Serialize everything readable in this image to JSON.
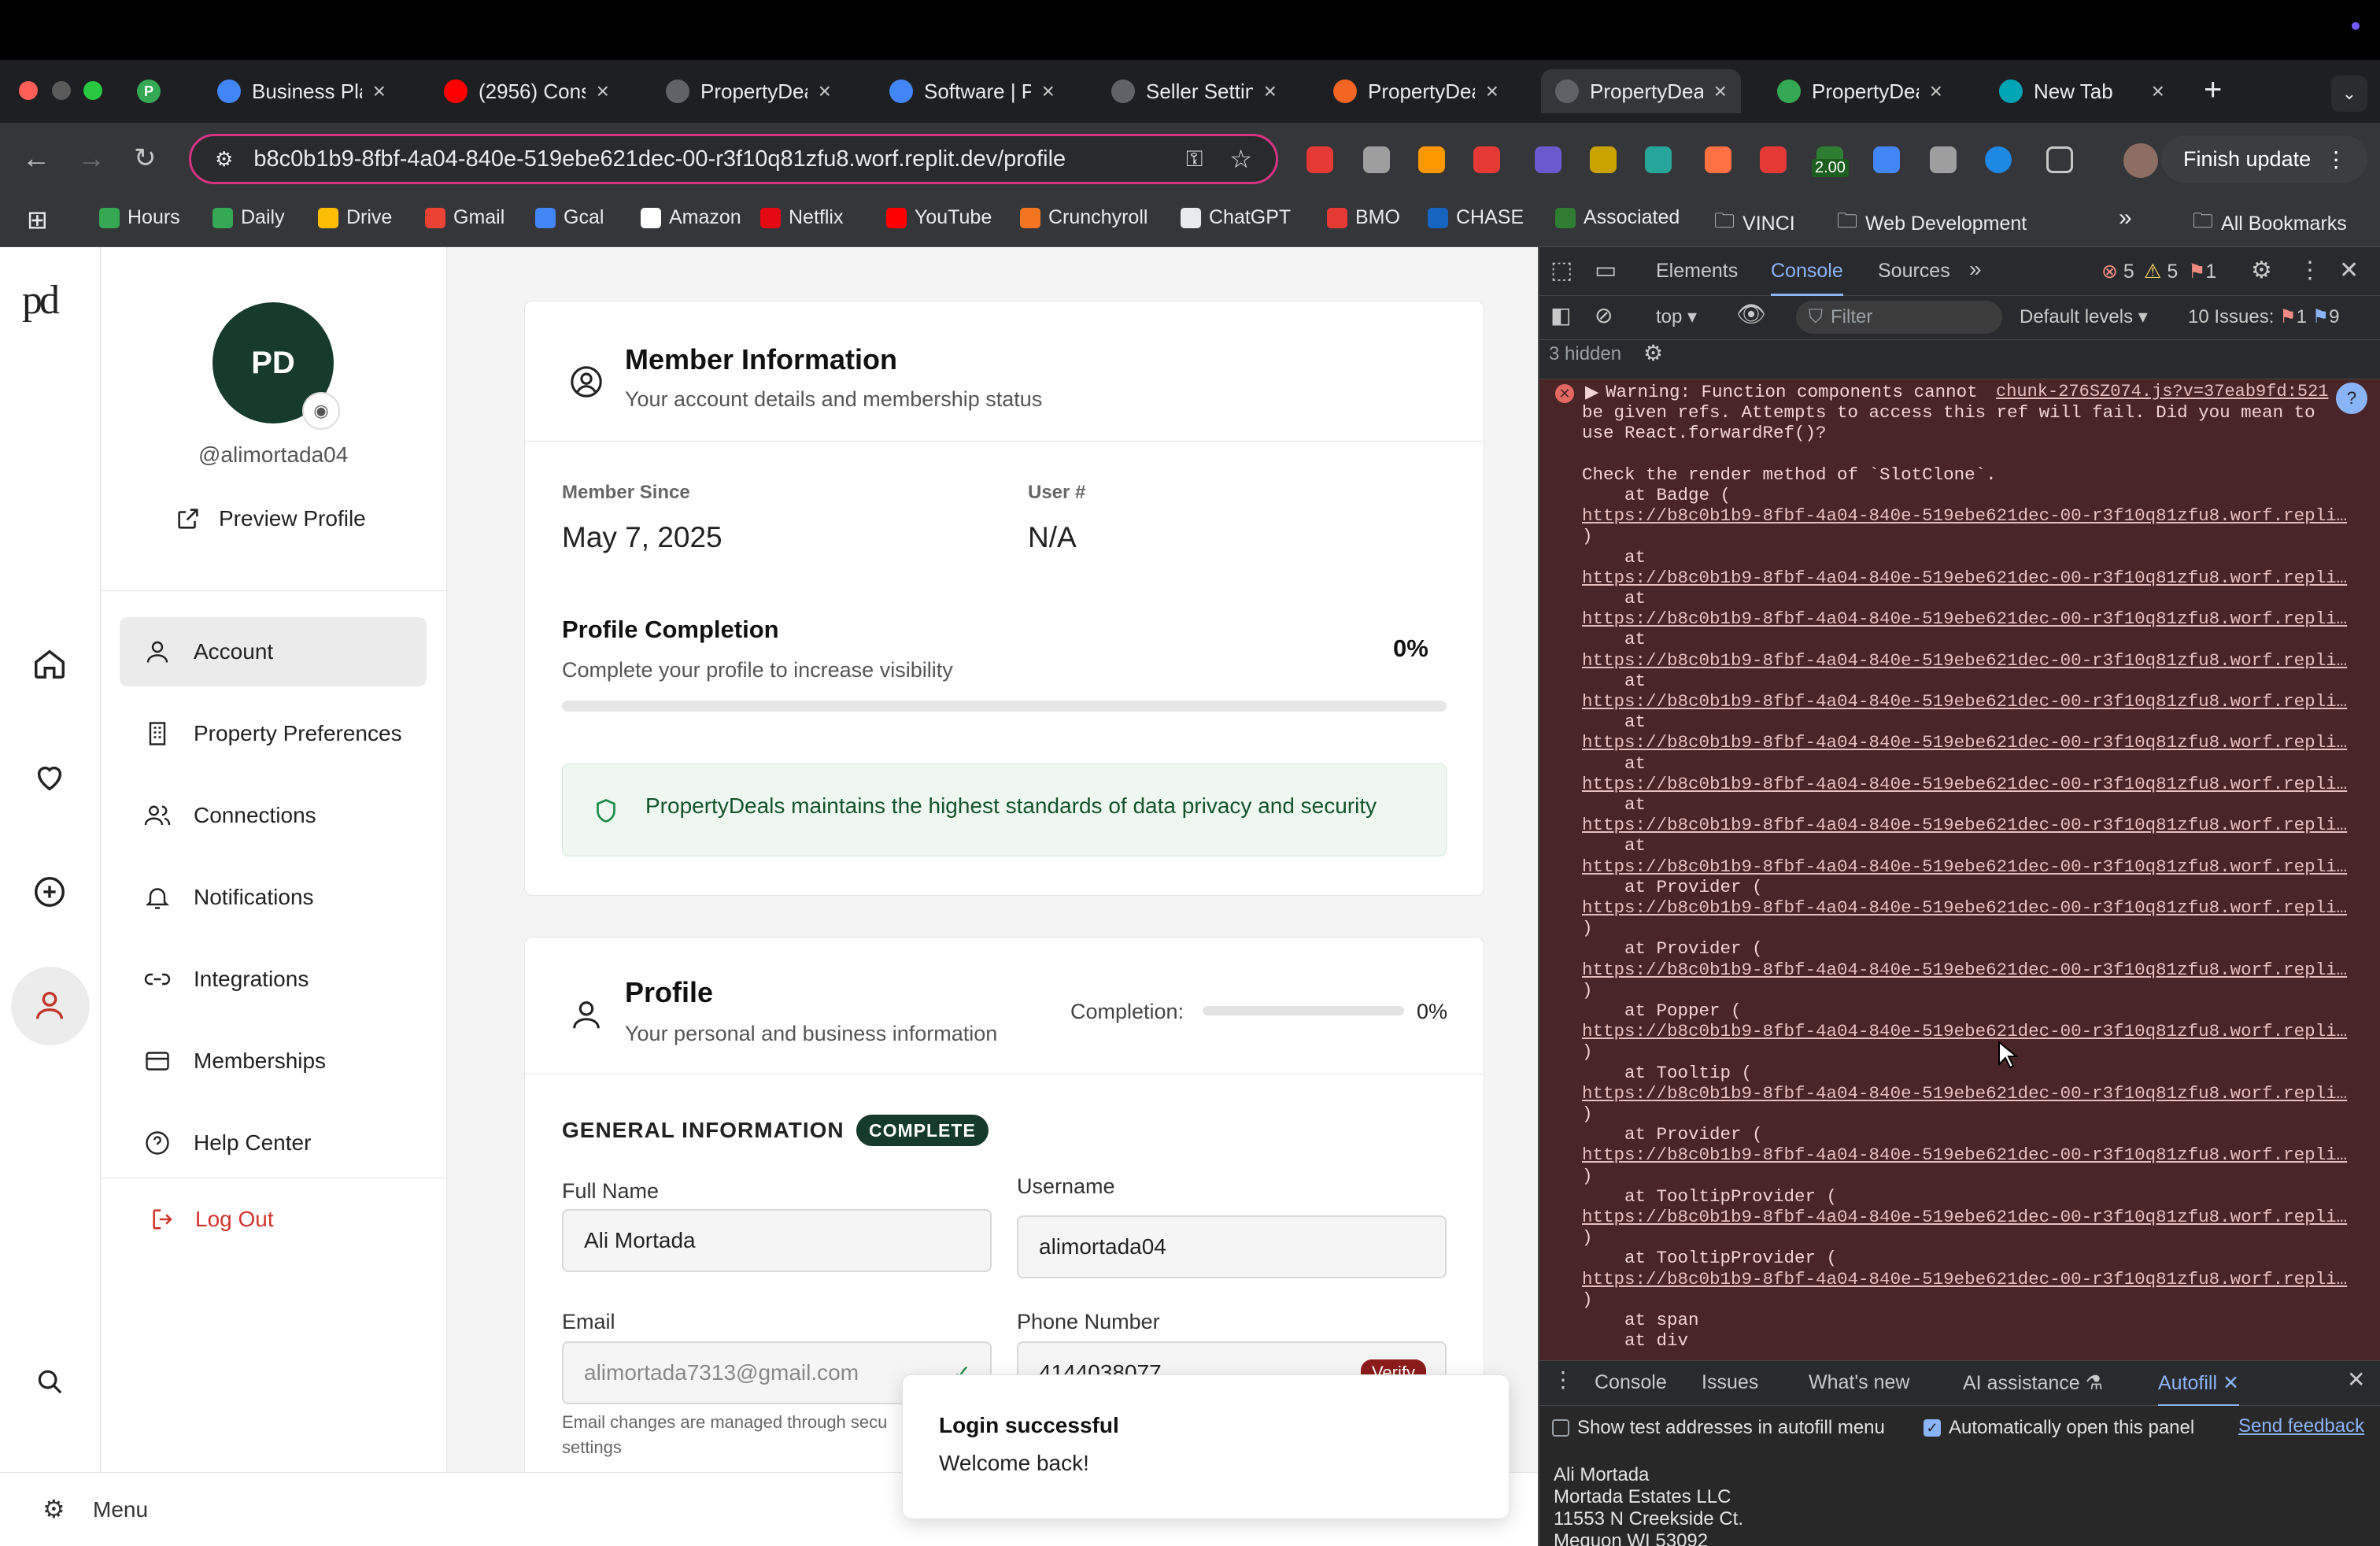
{
  "browser": {
    "tabs": [
      {
        "title": "Business Pla",
        "color": "#4285f4"
      },
      {
        "title": "(2956) Cons",
        "color": "#ff0000"
      },
      {
        "title": "PropertyDea",
        "color": "#5f6368"
      },
      {
        "title": "Software | P",
        "color": "#4285f4"
      },
      {
        "title": "Seller Settin",
        "color": "#5f6368"
      },
      {
        "title": "PropertyDea",
        "color": "#f26522"
      },
      {
        "title": "PropertyDea",
        "color": "#5f6368"
      },
      {
        "title": "PropertyDea",
        "color": "#34a853"
      },
      {
        "title": "New Tab",
        "color": "#00a5b5"
      }
    ],
    "url": "b8c0b1b9-8fbf-4a04-840e-519ebe621dec-00-r3f10q81zfu8.worf.replit.dev/profile",
    "ext_badge": "2.00",
    "finish_update": "Finish update",
    "bookmarks": [
      "Hours",
      "Daily",
      "Drive",
      "Gmail",
      "Gcal",
      "Amazon",
      "Netflix",
      "YouTube",
      "Crunchyroll",
      "ChatGPT",
      "BMO",
      "CHASE",
      "Associated",
      "VINCI",
      "Web Development"
    ],
    "all_bookmarks": "All Bookmarks"
  },
  "rail": {
    "logo": "pd",
    "menu_label": "Menu"
  },
  "sidebar": {
    "avatar_initials": "PD",
    "username": "@alimortada04",
    "preview": "Preview Profile",
    "items": [
      "Account",
      "Property Preferences",
      "Connections",
      "Notifications",
      "Integrations",
      "Memberships",
      "Help Center"
    ],
    "logout": "Log Out"
  },
  "member": {
    "title": "Member Information",
    "subtitle": "Your account details and membership status",
    "since_label": "Member Since",
    "since_value": "May 7, 2025",
    "user_label": "User #",
    "user_value": "N/A",
    "completion_title": "Profile Completion",
    "completion_sub": "Complete your profile to increase visibility",
    "completion_pct": "0%",
    "completion_fraction": 0,
    "privacy": "PropertyDeals maintains the highest standards of data privacy and security"
  },
  "profile": {
    "title": "Profile",
    "subtitle": "Your personal and business information",
    "completion_label": "Completion:",
    "completion_pct": "0%",
    "completion_fraction": 0,
    "section": "GENERAL INFORMATION",
    "badge": "COMPLETE",
    "fullname_label": "Full Name",
    "fullname": "Ali Mortada",
    "username_label": "Username",
    "username": "alimortada04",
    "email_label": "Email",
    "email": "alimortada7313@gmail.com",
    "phone_label": "Phone Number",
    "phone": "4144038077",
    "verify": "Verify",
    "email_note1": "Email changes are managed through secu",
    "email_note2": "settings"
  },
  "toast": {
    "title": "Login successful",
    "body": "Welcome back!"
  },
  "devtools": {
    "tabs": [
      "Elements",
      "Console",
      "Sources"
    ],
    "errors": "5",
    "warnings": "5",
    "issues_badge": "1",
    "context": "top",
    "filter": "Filter",
    "levels": "Default levels",
    "issues_label": "10 Issues:",
    "issues_err": "1",
    "issues_info": "9",
    "hidden": "3 hidden",
    "source_link": "chunk-276SZ074.js?v=37eab9fd:521",
    "lines": [
      "Warning: Function components cannot",
      "be given refs. Attempts to access this ref will fail. Did you mean to",
      "use React.forwardRef()?",
      "",
      "Check the render method of `SlotClone`.",
      "    at Badge (",
      "https://b8c0b1b9-8fbf-4a04-840e-519ebe621dec-00-r3f10q81zfu8.worf.repli…",
      ")",
      "    at",
      "https://b8c0b1b9-8fbf-4a04-840e-519ebe621dec-00-r3f10q81zfu8.worf.repli…",
      "    at",
      "https://b8c0b1b9-8fbf-4a04-840e-519ebe621dec-00-r3f10q81zfu8.worf.repli…",
      "    at",
      "https://b8c0b1b9-8fbf-4a04-840e-519ebe621dec-00-r3f10q81zfu8.worf.repli…",
      "    at",
      "https://b8c0b1b9-8fbf-4a04-840e-519ebe621dec-00-r3f10q81zfu8.worf.repli…",
      "    at",
      "https://b8c0b1b9-8fbf-4a04-840e-519ebe621dec-00-r3f10q81zfu8.worf.repli…",
      "    at",
      "https://b8c0b1b9-8fbf-4a04-840e-519ebe621dec-00-r3f10q81zfu8.worf.repli…",
      "    at",
      "https://b8c0b1b9-8fbf-4a04-840e-519ebe621dec-00-r3f10q81zfu8.worf.repli…",
      "    at",
      "https://b8c0b1b9-8fbf-4a04-840e-519ebe621dec-00-r3f10q81zfu8.worf.repli…",
      "    at Provider (",
      "https://b8c0b1b9-8fbf-4a04-840e-519ebe621dec-00-r3f10q81zfu8.worf.repli…",
      ")",
      "    at Provider (",
      "https://b8c0b1b9-8fbf-4a04-840e-519ebe621dec-00-r3f10q81zfu8.worf.repli…",
      ")",
      "    at Popper (",
      "https://b8c0b1b9-8fbf-4a04-840e-519ebe621dec-00-r3f10q81zfu8.worf.repli…",
      ")",
      "    at Tooltip (",
      "https://b8c0b1b9-8fbf-4a04-840e-519ebe621dec-00-r3f10q81zfu8.worf.repli…",
      ")",
      "    at Provider (",
      "https://b8c0b1b9-8fbf-4a04-840e-519ebe621dec-00-r3f10q81zfu8.worf.repli…",
      ")",
      "    at TooltipProvider (",
      "https://b8c0b1b9-8fbf-4a04-840e-519ebe621dec-00-r3f10q81zfu8.worf.repli…",
      ")",
      "    at TooltipProvider (",
      "https://b8c0b1b9-8fbf-4a04-840e-519ebe621dec-00-r3f10q81zfu8.worf.repli…",
      ")",
      "    at span",
      "    at div"
    ],
    "drawer_tabs": [
      "Console",
      "Issues",
      "What's new",
      "AI assistance",
      "Autofill"
    ],
    "show_test": "Show test addresses in autofill menu",
    "auto_open": "Automatically open this panel",
    "send_feedback": "Send feedback",
    "address": [
      "Ali Mortada",
      "Mortada Estates LLC",
      "11553 N Creekside Ct.",
      "Mequon WI 53092"
    ]
  }
}
